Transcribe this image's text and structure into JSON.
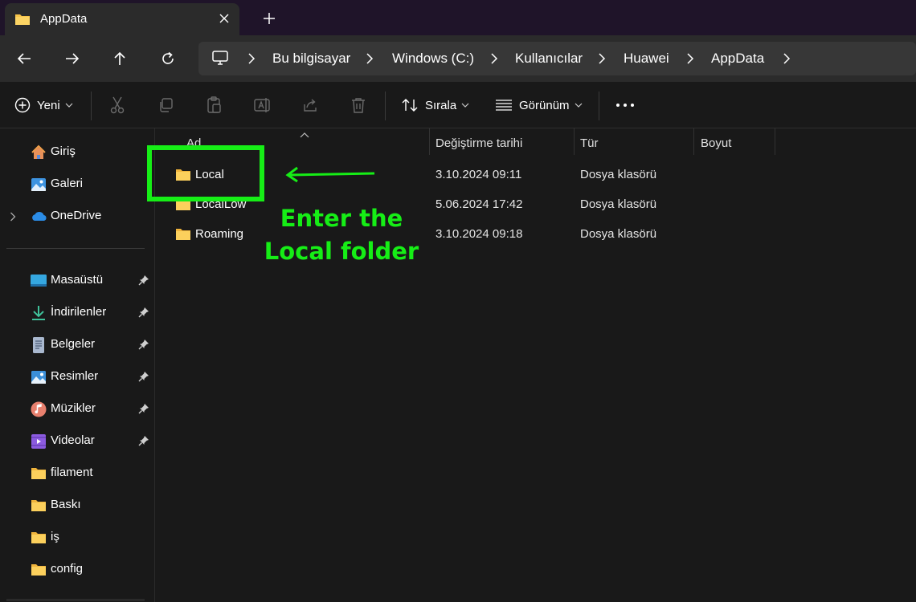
{
  "tab": {
    "title": "AppData",
    "icon": "folder-icon"
  },
  "breadcrumb": [
    "Bu bilgisayar",
    "Windows (C:)",
    "Kullanıcılar",
    "Huawei",
    "AppData"
  ],
  "toolbar": {
    "new_label": "Yeni",
    "sort_label": "Sırala",
    "view_label": "Görünüm"
  },
  "sidebar": {
    "top_items": [
      {
        "label": "Giriş",
        "icon": "home-icon"
      },
      {
        "label": "Galeri",
        "icon": "gallery-icon"
      },
      {
        "label": "OneDrive",
        "icon": "cloud-icon"
      }
    ],
    "pinned_items": [
      {
        "label": "Masaüstü",
        "icon": "desktop-icon"
      },
      {
        "label": "İndirilenler",
        "icon": "download-icon"
      },
      {
        "label": "Belgeler",
        "icon": "document-icon"
      },
      {
        "label": "Resimler",
        "icon": "pictures-icon"
      },
      {
        "label": "Müzikler",
        "icon": "music-icon"
      },
      {
        "label": "Videolar",
        "icon": "video-icon"
      }
    ],
    "folders": [
      {
        "label": "filament"
      },
      {
        "label": "Baskı"
      },
      {
        "label": "iş"
      },
      {
        "label": "config"
      }
    ]
  },
  "columns": {
    "name": "Ad",
    "date": "Değiştirme tarihi",
    "type": "Tür",
    "size": "Boyut"
  },
  "files": [
    {
      "name": "Local",
      "date": "3.10.2024 09:11",
      "type": "Dosya klasörü",
      "size": ""
    },
    {
      "name": "LocalLow",
      "date": "5.06.2024 17:42",
      "type": "Dosya klasörü",
      "size": ""
    },
    {
      "name": "Roaming",
      "date": "3.10.2024 09:18",
      "type": "Dosya klasörü",
      "size": ""
    }
  ],
  "annotation": {
    "line1": "Enter the",
    "line2": "Local folder",
    "color": "#16ee16"
  },
  "colors": {
    "folder": "#f8c54a",
    "titlebar": "#1f1429",
    "panel": "#2b2b2b",
    "background": "#191919"
  }
}
